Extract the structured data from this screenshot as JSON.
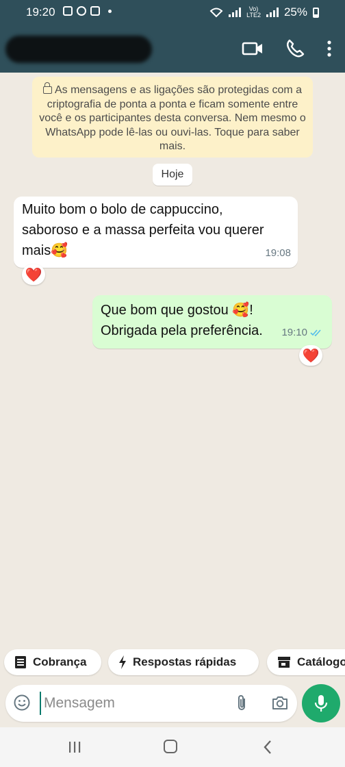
{
  "status_bar": {
    "time": "19:20",
    "volte": "Vo)\nLTE2",
    "battery": "25%"
  },
  "header": {
    "icons": [
      "video-call-icon",
      "phone-icon",
      "menu-icon"
    ]
  },
  "chat": {
    "encryption_notice": "As mensagens e as ligações são protegidas com a criptografia de ponta a ponta e ficam somente entre você e os participantes desta conversa. Nem mesmo o WhatsApp pode lê-las ou ouvi-las. Toque para saber mais.",
    "date_chip": "Hoje",
    "messages": [
      {
        "direction": "in",
        "text": "Muito bom o bolo de cappuccino, saboroso  e a massa  perfeita  vou querer mais🥰",
        "time": "19:08",
        "reaction": "❤️"
      },
      {
        "direction": "out",
        "text_line1": "Que bom que gostou 🥰!",
        "text_line2": "Obrigada pela preferência.",
        "time": "19:10",
        "reaction": "❤️"
      }
    ]
  },
  "quick_chips": [
    {
      "label": "Cobrança",
      "icon": "invoice-icon"
    },
    {
      "label": "Respostas rápidas",
      "icon": "lightning-icon"
    },
    {
      "label": "Catálogo",
      "icon": "store-icon"
    }
  ],
  "composer": {
    "placeholder": "Mensagem"
  },
  "colors": {
    "header": "#2f4f5a",
    "chat_bg": "#efeae2",
    "outgoing": "#d9fdd3",
    "accent": "#1faa6c",
    "notice": "#fdf1c9"
  }
}
